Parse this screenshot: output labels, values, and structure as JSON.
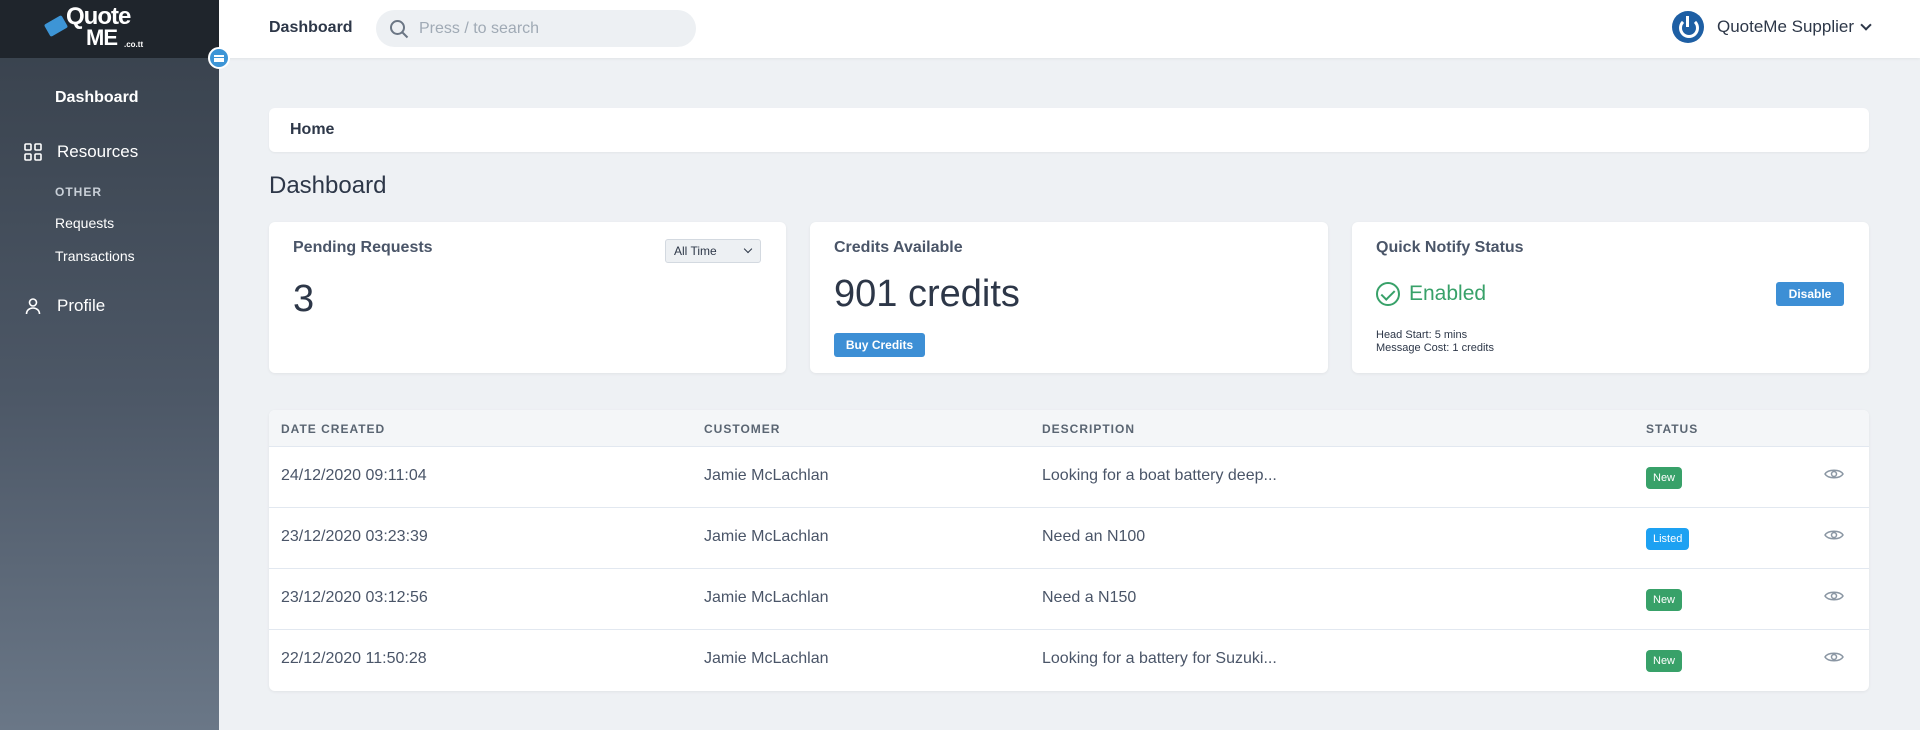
{
  "brand": {
    "line1": "Quote",
    "line2": "ME",
    "suffix": ".co.tt"
  },
  "sidebar": {
    "dashboard": "Dashboard",
    "resources": "Resources",
    "section_other": "OTHER",
    "requests": "Requests",
    "transactions": "Transactions",
    "profile": "Profile"
  },
  "header": {
    "title": "Dashboard",
    "search_placeholder": "Press / to search",
    "user_name": "QuoteMe Supplier"
  },
  "breadcrumb": "Home",
  "page_title": "Dashboard",
  "cards": {
    "pending": {
      "title": "Pending Requests",
      "value": "3",
      "filter": "All Time"
    },
    "credits": {
      "title": "Credits Available",
      "value": "901 credits",
      "button": "Buy Credits"
    },
    "notify": {
      "title": "Quick Notify Status",
      "status": "Enabled",
      "button": "Disable",
      "head_start": "Head Start: 5 mins",
      "message_cost": "Message Cost: 1 credits"
    }
  },
  "table": {
    "headers": {
      "date": "DATE CREATED",
      "customer": "CUSTOMER",
      "description": "DESCRIPTION",
      "status": "STATUS"
    },
    "rows": [
      {
        "date": "24/12/2020 09:11:04",
        "customer": "Jamie McLachlan",
        "description": "Looking for a boat battery deep...",
        "status": "New"
      },
      {
        "date": "23/12/2020 03:23:39",
        "customer": "Jamie McLachlan",
        "description": "Need an N100",
        "status": "Listed"
      },
      {
        "date": "23/12/2020 03:12:56",
        "customer": "Jamie McLachlan",
        "description": "Need a N150",
        "status": "New"
      },
      {
        "date": "22/12/2020 11:50:28",
        "customer": "Jamie McLachlan",
        "description": "Looking for a battery for Suzuki...",
        "status": "New"
      }
    ]
  },
  "colors": {
    "accent": "#3d8fd5",
    "badge_new": "#38a169",
    "badge_listed": "#1da1f2",
    "sidebar_top": "#37404b"
  }
}
